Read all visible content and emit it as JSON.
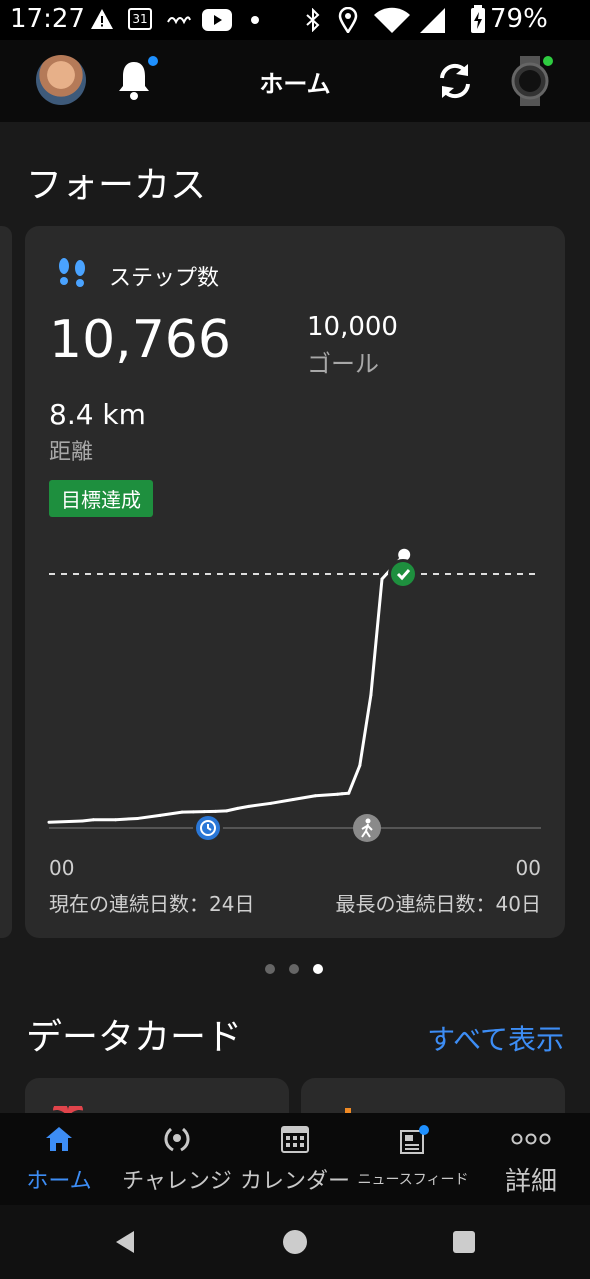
{
  "status_bar": {
    "time": "17:27",
    "calendar_date": "31",
    "battery": "79%",
    "icons": [
      "warning-icon",
      "calendar-icon",
      "app-logo-icon",
      "youtube-icon",
      "dot-icon",
      "bluetooth-icon",
      "location-icon",
      "wifi-icon",
      "signal-icon",
      "battery-icon"
    ]
  },
  "header": {
    "title": "ホーム",
    "notification_dot_color": "#1e90ff",
    "device_status_color": "#2ecc40"
  },
  "focus": {
    "section_title": "フォーカス",
    "card": {
      "label": "ステップ数",
      "steps": "10,766",
      "goal_value": "10,000",
      "goal_label": "ゴール",
      "distance_value": "8.4 km",
      "distance_label": "距離",
      "badge": "目標達成",
      "time_start": "00",
      "time_end": "00",
      "streak_current": "現在の連続日数：24日",
      "streak_longest": "最長の連続日数：40日"
    },
    "pager": {
      "count": 3,
      "active": 2
    }
  },
  "chart_data": {
    "type": "line",
    "title": "",
    "goal": 10000,
    "total": 10766,
    "x": [
      0,
      1.5,
      2,
      3,
      4,
      5,
      6,
      6.5,
      7,
      7.5,
      8,
      8.5,
      9,
      10,
      11,
      12,
      13,
      13.2,
      13.5,
      14,
      14.5,
      15,
      16
    ],
    "y": [
      150,
      200,
      250,
      250,
      300,
      420,
      550,
      560,
      570,
      580,
      600,
      700,
      780,
      900,
      1050,
      1200,
      1260,
      1280,
      1300,
      2400,
      5200,
      9800,
      10766
    ],
    "xlabel": "",
    "ylabel": "",
    "markers": [
      "alarm-clock-icon",
      "walking-icon",
      "goal-check-icon"
    ]
  },
  "datacards": {
    "section_title": "データカード",
    "show_all": "すべて表示"
  },
  "bottom_nav": [
    {
      "label": "ホーム",
      "icon": "home-icon",
      "active": true
    },
    {
      "label": "チャレンジ",
      "icon": "laurel-icon",
      "active": false
    },
    {
      "label": "カレンダー",
      "icon": "calendar-grid-icon",
      "active": false
    },
    {
      "label": "ニュースフィード",
      "icon": "newsfeed-icon",
      "active": false,
      "dot_color": "#1e90ff"
    },
    {
      "label": "詳細",
      "icon": "more-icon",
      "active": false
    }
  ],
  "colors": {
    "accent": "#3d8df5",
    "goal_green": "#1e8f3e",
    "card_bg": "#2a2a2a"
  }
}
